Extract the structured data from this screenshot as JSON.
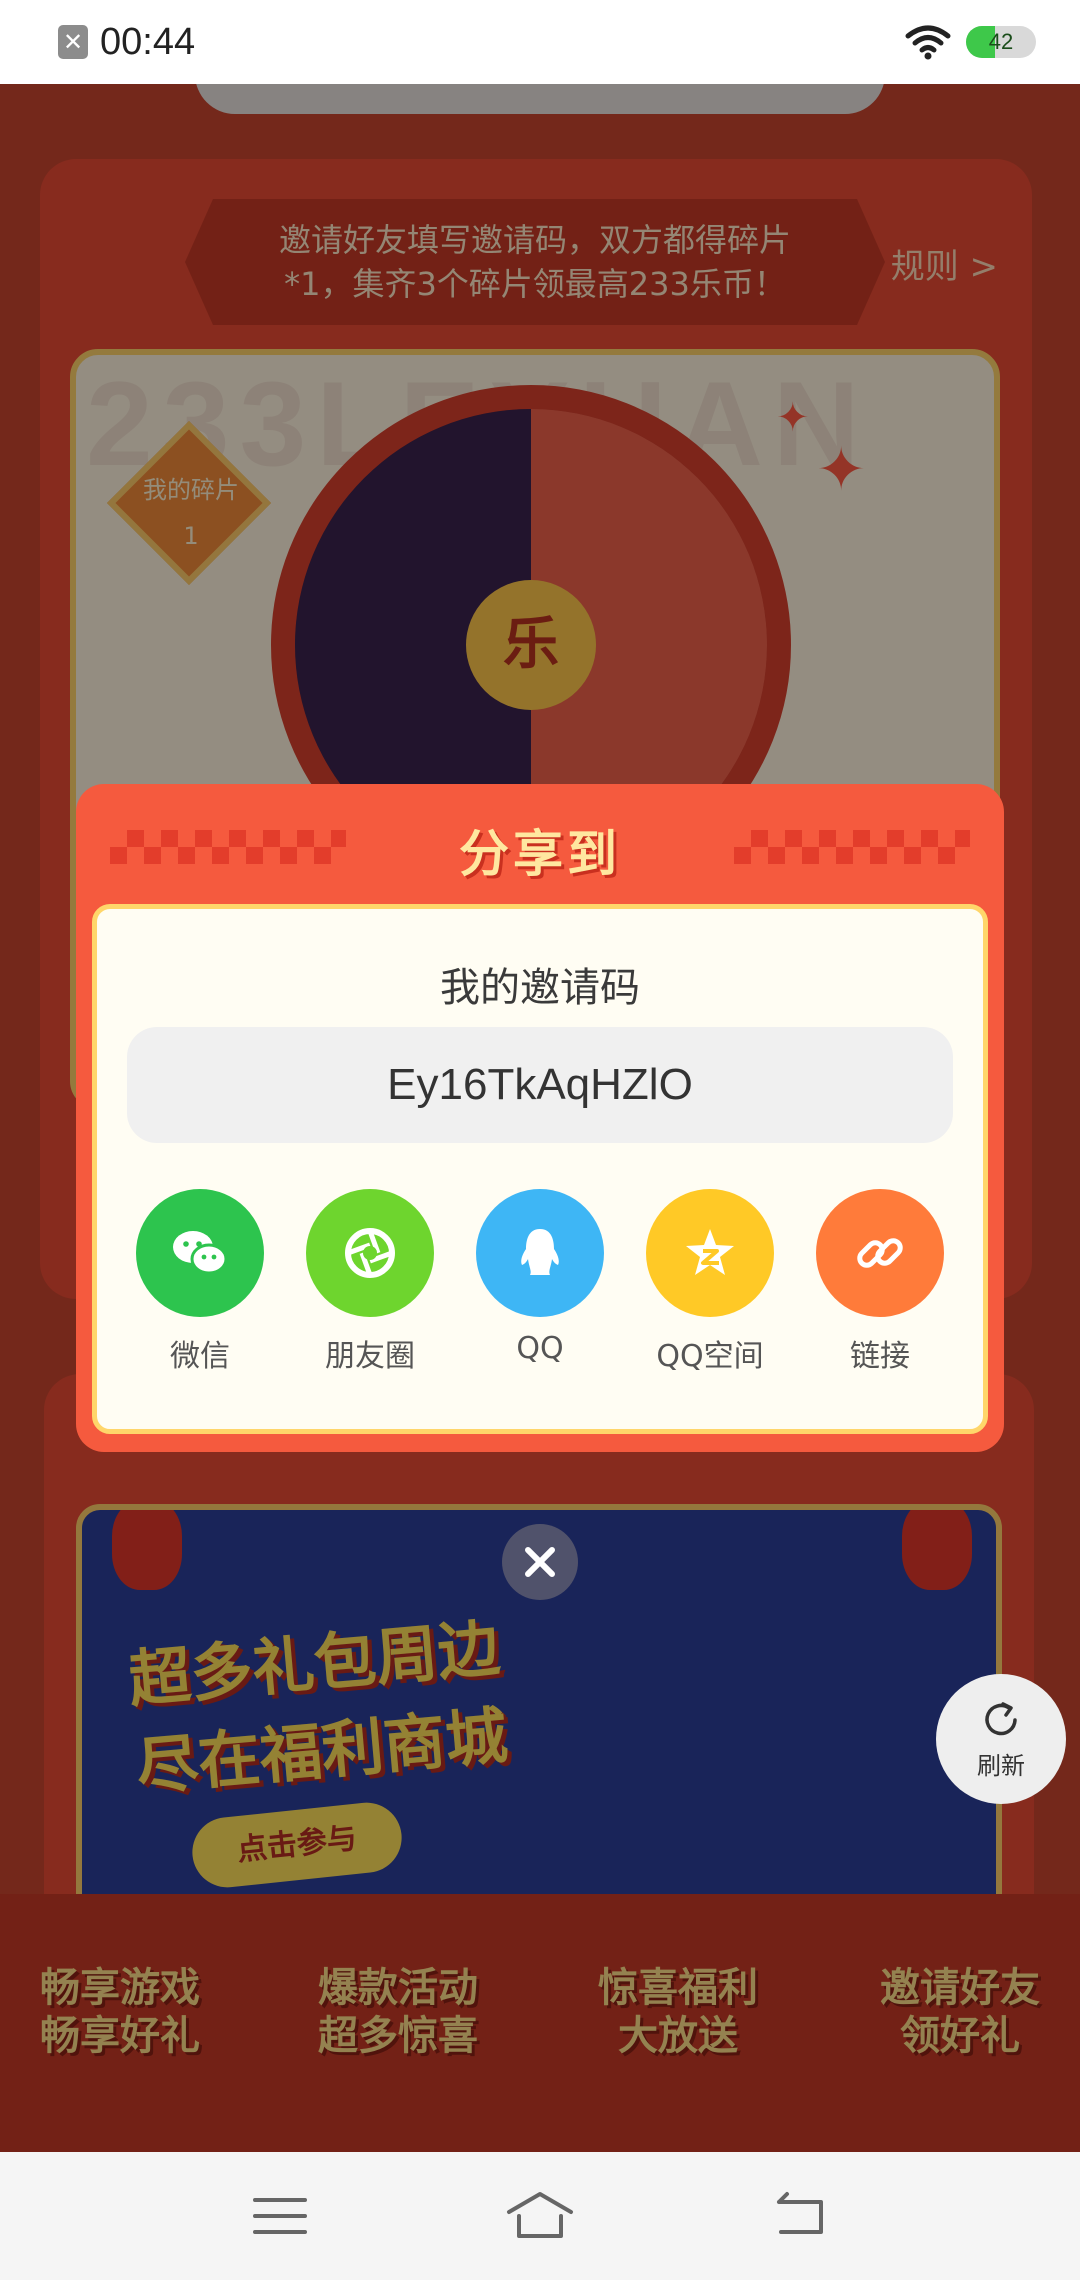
{
  "status_bar": {
    "time": "00:44",
    "battery_percent": 42,
    "battery_label": "42",
    "icons": [
      "notification-x-icon",
      "wifi-icon",
      "battery-icon"
    ]
  },
  "background": {
    "rules_text_line1": "邀请好友填写邀请码，双方都得碎片",
    "rules_text_line2": "*1，集齐3个碎片领最高233乐币！",
    "rules_link": "规则 >",
    "watermark": "233LEYUAN",
    "fragment_label": "我的碎片",
    "fragment_count": "1",
    "wheel_center": "乐",
    "mall_title_line1": "超多礼包周边",
    "mall_title_line2": "尽在福利商城",
    "mall_button": "点击参与",
    "features": [
      {
        "line1": "畅享游戏",
        "line2": "畅享好礼"
      },
      {
        "line1": "爆款活动",
        "line2": "超多惊喜"
      },
      {
        "line1": "惊喜福利",
        "line2": "大放送"
      },
      {
        "line1": "邀请好友",
        "line2": "领好礼"
      }
    ],
    "refresh_label": "刷新"
  },
  "dialog": {
    "title": "分享到",
    "code_label": "我的邀请码",
    "invite_code": "Ey16TkAqHZlO",
    "share_options": [
      {
        "label": "微信",
        "icon": "wechat-icon",
        "color": "#2dc44e"
      },
      {
        "label": "朋友圈",
        "icon": "moments-icon",
        "color": "#6ed52e"
      },
      {
        "label": "QQ",
        "icon": "qq-icon",
        "color": "#3eb6f5"
      },
      {
        "label": "QQ空间",
        "icon": "qzone-icon",
        "color": "#ffc926"
      },
      {
        "label": "链接",
        "icon": "link-icon",
        "color": "#ff7b3a"
      }
    ]
  },
  "colors": {
    "dialog_red": "#f55a3e",
    "dialog_gold": "#ffd66a",
    "page_red": "#e84b34"
  }
}
